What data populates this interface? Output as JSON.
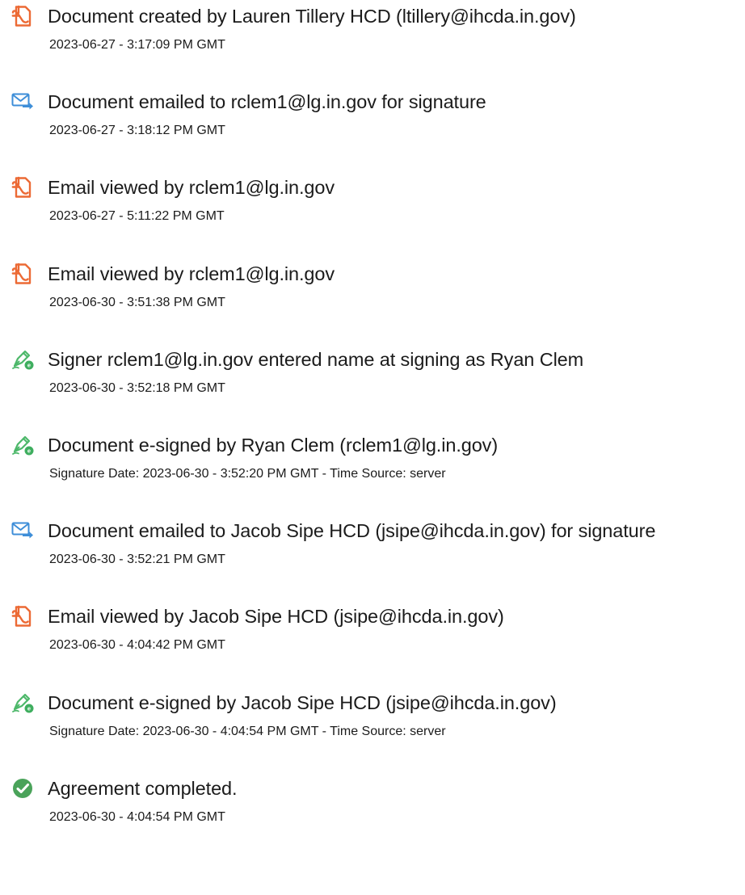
{
  "colors": {
    "doc_icon": "#ec6a35",
    "mail_icon": "#3e8ed8",
    "sign_icon": "#4db86a",
    "complete_icon": "#4aa35a"
  },
  "events": [
    {
      "icon": "document-icon",
      "title": "Document created by Lauren Tillery HCD (ltillery@ihcda.in.gov)",
      "stamp": "2023-06-27 - 3:17:09 PM GMT"
    },
    {
      "icon": "email-icon",
      "title": "Document emailed to rclem1@lg.in.gov for signature",
      "stamp": "2023-06-27 - 3:18:12 PM GMT"
    },
    {
      "icon": "document-icon",
      "title": "Email viewed by rclem1@lg.in.gov",
      "stamp": "2023-06-27 - 5:11:22 PM GMT"
    },
    {
      "icon": "document-icon",
      "title": "Email viewed by rclem1@lg.in.gov",
      "stamp": "2023-06-30 - 3:51:38 PM GMT"
    },
    {
      "icon": "signature-icon",
      "title": "Signer rclem1@lg.in.gov entered name at signing as Ryan Clem",
      "stamp": "2023-06-30 - 3:52:18 PM GMT"
    },
    {
      "icon": "signature-icon",
      "title": "Document e-signed by Ryan Clem (rclem1@lg.in.gov)",
      "stamp": "Signature Date: 2023-06-30 - 3:52:20 PM GMT - Time Source: server"
    },
    {
      "icon": "email-icon",
      "title": "Document emailed to Jacob Sipe HCD (jsipe@ihcda.in.gov) for signature",
      "stamp": "2023-06-30 - 3:52:21 PM GMT"
    },
    {
      "icon": "document-icon",
      "title": "Email viewed by Jacob Sipe HCD (jsipe@ihcda.in.gov)",
      "stamp": "2023-06-30 - 4:04:42 PM GMT"
    },
    {
      "icon": "signature-icon",
      "title": "Document e-signed by Jacob Sipe HCD (jsipe@ihcda.in.gov)",
      "stamp": "Signature Date: 2023-06-30 - 4:04:54 PM GMT - Time Source: server"
    },
    {
      "icon": "check-circle-icon",
      "title": "Agreement completed.",
      "stamp": "2023-06-30 - 4:04:54 PM GMT"
    }
  ]
}
